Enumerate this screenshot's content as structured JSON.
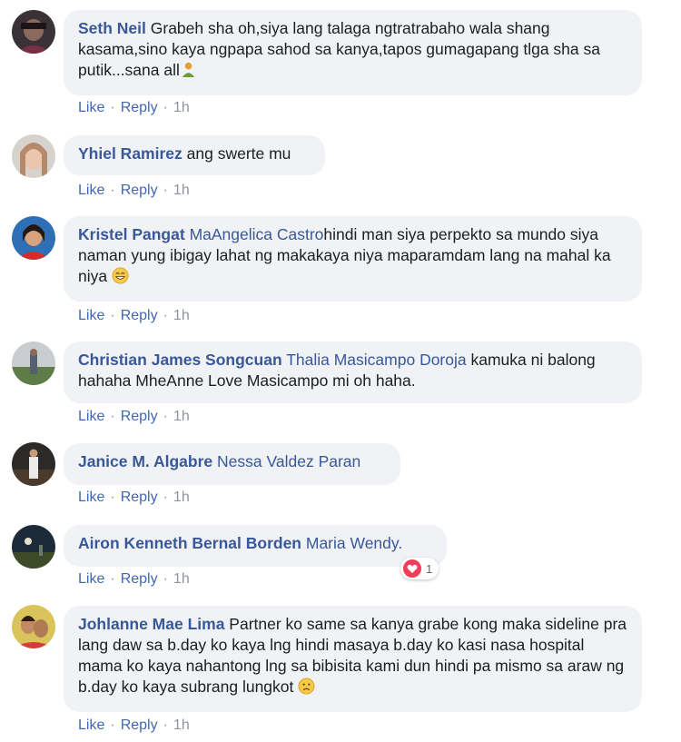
{
  "comments": [
    {
      "author": "Seth Neil",
      "mention": "",
      "text": " Grabeh sha oh,siya lang talaga ngtratrabaho wala shang kasama,sino kaya ngpapa sahod sa kanya,tapos gumagapang tlga sha sa putik...sana all",
      "emoji": "person-gesturing-icon",
      "like": "Like",
      "reply": "Reply",
      "time": "1h"
    },
    {
      "author": "Yhiel Ramirez",
      "mention": "",
      "text": " ang swerte mu",
      "like": "Like",
      "reply": "Reply",
      "time": "1h"
    },
    {
      "author": "Kristel Pangat",
      "mention": "MaAngelica Castro",
      "text": "hindi man siya perpekto sa mundo siya naman yung ibigay lahat ng makakaya niya maparamdam lang na mahal ka niya ",
      "emoji": "grinning-smile-emoji-icon",
      "like": "Like",
      "reply": "Reply",
      "time": "1h"
    },
    {
      "author": "Christian James Songcuan",
      "mention": "Thalia Masicampo Doroja",
      "text": " kamuka ni balong hahaha MheAnne Love Masicampo mi oh haha.",
      "like": "Like",
      "reply": "Reply",
      "time": "1h"
    },
    {
      "author": "Janice M. Algabre",
      "mention": "Nessa Valdez Paran",
      "text": "",
      "like": "Like",
      "reply": "Reply",
      "time": "1h"
    },
    {
      "author": "Airon Kenneth Bernal Borden",
      "mention": "Maria Wendy.",
      "text": "",
      "reaction_icon": "heart-icon",
      "reaction_count": "1",
      "like": "Like",
      "reply": "Reply",
      "time": "1h"
    },
    {
      "author": "Johlanne Mae Lima",
      "mention": "",
      "text": " Partner ko same sa kanya grabe kong maka sideline pra lang daw sa b.day ko kaya lng hindi masaya b.day ko kasi nasa hospital mama ko kaya nahantong lng sa bibisita kami dun hindi pa mismo sa araw ng b.day ko kaya subrang lungkot ",
      "emoji": "sad-face-emoji-icon",
      "like": "Like",
      "reply": "Reply",
      "time": "1h"
    }
  ],
  "colors": {
    "name": "#385898",
    "link": "#4267b2",
    "meta": "#90949c",
    "bubble": "#f0f2f5",
    "heart": "#f33e58"
  }
}
